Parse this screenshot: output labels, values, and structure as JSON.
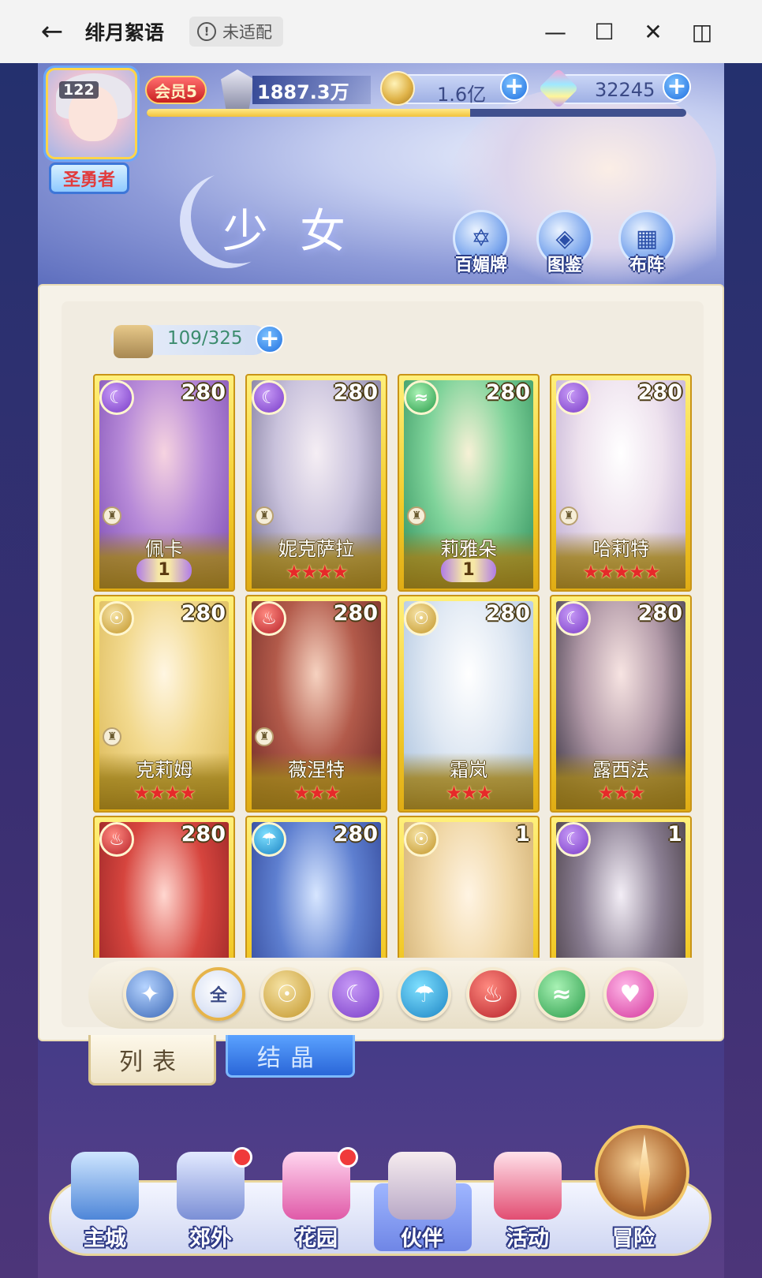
{
  "window": {
    "title": "绯月絮语",
    "badge": "未适配",
    "back_icon": "back-arrow-icon"
  },
  "player": {
    "level": "122",
    "title": "圣勇者",
    "vip": "会员5",
    "power": "1887.3万",
    "exp_progress": 0.6
  },
  "resources": {
    "coins": "1.6亿",
    "gems": "32245"
  },
  "header": {
    "page_title": "少女",
    "buttons": [
      "百媚牌",
      "图鉴",
      "布阵"
    ]
  },
  "collection": {
    "count": "109/325"
  },
  "cards": [
    {
      "name": "佩卡",
      "level": "280",
      "element": "moon",
      "stars": "",
      "wing": "1"
    },
    {
      "name": "妮克萨拉",
      "level": "280",
      "element": "moon",
      "stars": "★★★★",
      "wing": ""
    },
    {
      "name": "莉雅朵",
      "level": "280",
      "element": "wind",
      "stars": "",
      "wing": "1"
    },
    {
      "name": "哈莉特",
      "level": "280",
      "element": "moon",
      "stars": "★★★★★",
      "wing": ""
    },
    {
      "name": "克莉姆",
      "level": "280",
      "element": "sun",
      "stars": "★★★★",
      "wing": ""
    },
    {
      "name": "薇涅特",
      "level": "280",
      "element": "fire",
      "stars": "★★★",
      "wing": ""
    },
    {
      "name": "霜岚",
      "level": "280",
      "element": "sun",
      "stars": "★★★",
      "wing": ""
    },
    {
      "name": "露西法",
      "level": "280",
      "element": "moon",
      "stars": "★★★",
      "wing": ""
    },
    {
      "name": "",
      "level": "280",
      "element": "fire",
      "stars": "",
      "wing": ""
    },
    {
      "name": "",
      "level": "280",
      "element": "water",
      "stars": "",
      "wing": ""
    },
    {
      "name": "",
      "level": "1",
      "element": "sun",
      "stars": "",
      "wing": ""
    },
    {
      "name": "",
      "level": "1",
      "element": "moon",
      "stars": "",
      "wing": ""
    }
  ],
  "filters": {
    "all_label": "全",
    "icons": [
      "star-filter-icon",
      "all-filter-icon",
      "sun-filter-icon",
      "moon-filter-icon",
      "water-filter-icon",
      "fire-filter-icon",
      "wind-filter-icon",
      "heart-filter-icon"
    ]
  },
  "tabs": {
    "list": "列表",
    "crystal": "结晶"
  },
  "nav": [
    "主城",
    "郊外",
    "花园",
    "伙伴",
    "活动",
    "冒险"
  ],
  "colors": {
    "card_gold": "#f3cb2a",
    "accent_blue": "#1f6fe0",
    "moon": "#7a3dc8",
    "sun": "#c3962a",
    "fire": "#b8232a",
    "water": "#1c84c4",
    "wind": "#2a9c4a"
  }
}
